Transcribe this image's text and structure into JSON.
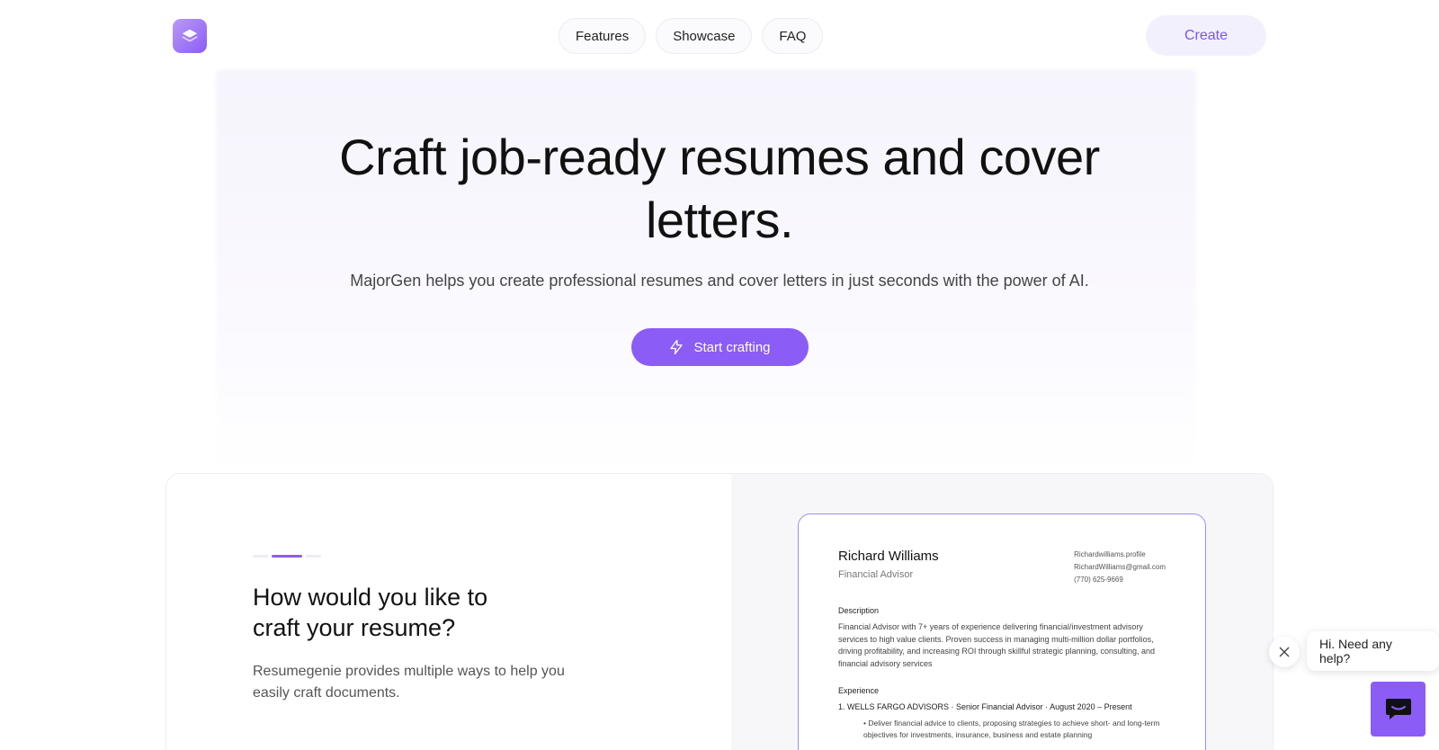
{
  "nav": {
    "links": [
      "Features",
      "Showcase",
      "FAQ"
    ],
    "create_label": "Create"
  },
  "hero": {
    "title": "Craft job-ready resumes and cover letters.",
    "subtitle": "MajorGen helps you create professional resumes and cover letters in just seconds with the power of AI.",
    "cta_label": "Start crafting"
  },
  "card": {
    "title": "How would you like to craft your resume?",
    "text": "Resumegenie provides multiple ways to help you easily craft documents."
  },
  "resume": {
    "name": "Richard Williams",
    "role": "Financial Advisor",
    "contact": [
      "Richardwilliams.profile",
      "RichardWilliams@gmail.com",
      "(770) 625-9669"
    ],
    "description_heading": "Description",
    "description": "Financial Advisor with 7+ years of experience delivering financial/investment advisory services to high value clients. Proven success in managing multi-million dollar portfolios, driving profitability, and increasing ROI through skillful strategic planning, consulting, and financial advisory services",
    "experience_heading": "Experience",
    "experience_item": "1.  WELLS FARGO ADVISORS · Senior Financial Advisor · August 2020 – Present",
    "experience_bullet": "• Deliver financial advice to clients, proposing strategies to achieve short- and long-term objectives for investments, insurance, business and estate planning"
  },
  "chat": {
    "bubble_text": "Hi. Need any help?"
  },
  "colors": {
    "accent": "#8b5cf6",
    "accent_light": "#f3f0fd"
  }
}
